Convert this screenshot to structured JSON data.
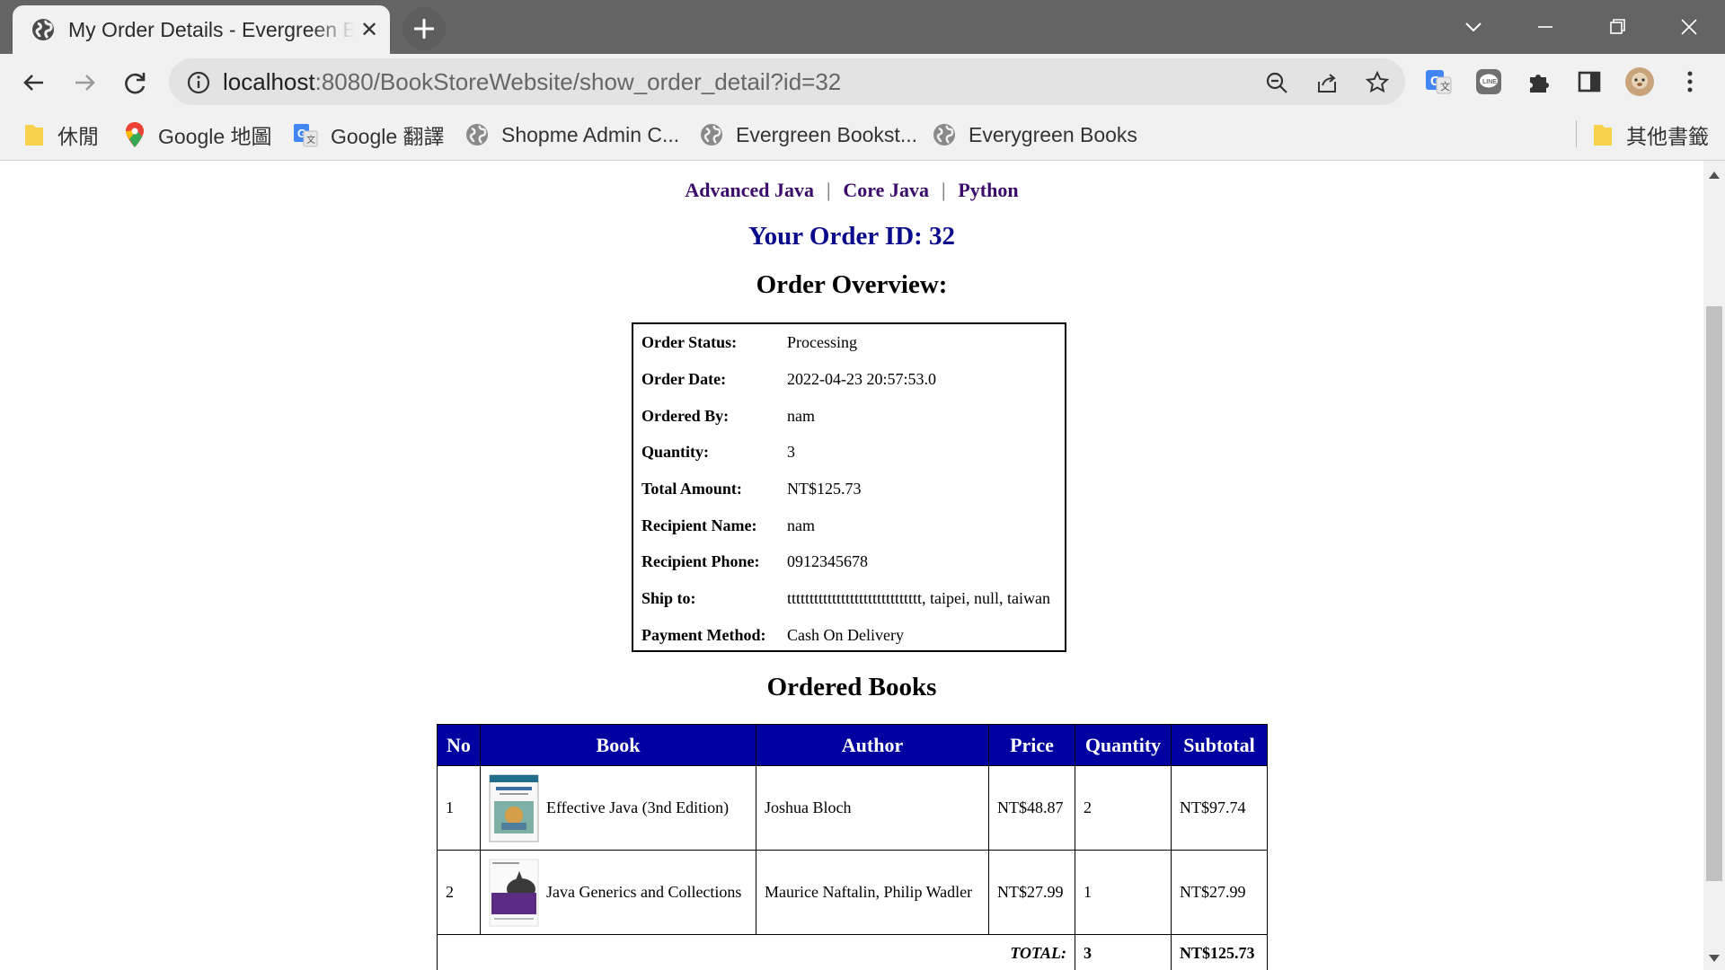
{
  "browser": {
    "tab_title": "My Order Details - Evergreen Books",
    "url_host": "localhost",
    "url_rest": ":8080/BookStoreWebsite/show_order_detail?id=32",
    "bookmarks": [
      "休閒",
      "Google 地圖",
      "Google 翻譯",
      "Shopme Admin C...",
      "Evergreen Bookst...",
      "Everygreen Books"
    ],
    "other_bookmarks": "其他書籤"
  },
  "categories": [
    "Advanced Java",
    "Core Java",
    "Python"
  ],
  "category_separator": "|",
  "order_id_heading": "Your Order ID: 32",
  "overview_heading": "Order Overview:",
  "overview": [
    {
      "label": "Order Status:",
      "value": "Processing"
    },
    {
      "label": "Order Date:",
      "value": "2022-04-23 20:57:53.0"
    },
    {
      "label": "Ordered By:",
      "value": "nam"
    },
    {
      "label": "Quantity:",
      "value": "3"
    },
    {
      "label": "Total Amount:",
      "value": "NT$125.73"
    },
    {
      "label": "Recipient Name:",
      "value": "nam"
    },
    {
      "label": "Recipient Phone:",
      "value": "0912345678"
    },
    {
      "label": "Ship to:",
      "value": "tttttttttttttttttttttttttttttt, taipei, null, taiwan"
    },
    {
      "label": "Payment Method:",
      "value": "Cash On Delivery"
    }
  ],
  "books_heading": "Ordered Books",
  "books_table": {
    "headers": [
      "No",
      "Book",
      "Author",
      "Price",
      "Quantity",
      "Subtotal"
    ],
    "rows": [
      {
        "no": "1",
        "book": "Effective Java (3nd Edition)",
        "author": "Joshua Bloch",
        "price": "NT$48.87",
        "quantity": "2",
        "subtotal": "NT$97.74"
      },
      {
        "no": "2",
        "book": "Java Generics and Collections",
        "author": "Maurice Naftalin, Philip Wadler",
        "price": "NT$27.99",
        "quantity": "1",
        "subtotal": "NT$27.99"
      }
    ],
    "total_label": "TOTAL:",
    "total_quantity": "3",
    "total_amount": "NT$125.73"
  },
  "colors": {
    "header_bg": "#0000a0",
    "order_id": "#0a0a8c",
    "category_link": "#3b0a6b"
  }
}
